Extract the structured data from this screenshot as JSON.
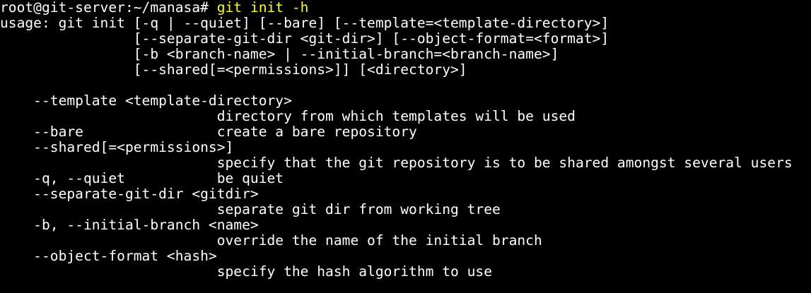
{
  "terminal": {
    "prompt": "root@git-server:~/manasa#",
    "command": "git init -h",
    "output_lines": [
      "usage: git init [-q | --quiet] [--bare] [--template=<template-directory>]",
      "                [--separate-git-dir <git-dir>] [--object-format=<format>]",
      "                [-b <branch-name> | --initial-branch=<branch-name>]",
      "                [--shared[=<permissions>]] [<directory>]",
      "",
      "    --template <template-directory>",
      "                          directory from which templates will be used",
      "    --bare                create a bare repository",
      "    --shared[=<permissions>]",
      "                          specify that the git repository is to be shared amongst several users",
      "    -q, --quiet           be quiet",
      "    --separate-git-dir <gitdir>",
      "                          separate git dir from working tree",
      "    -b, --initial-branch <name>",
      "                          override the name of the initial branch",
      "    --object-format <hash>",
      "                          specify the hash algorithm to use"
    ]
  },
  "colors": {
    "background": "#000000",
    "text": "#ffffff",
    "command": "#ffff00"
  }
}
